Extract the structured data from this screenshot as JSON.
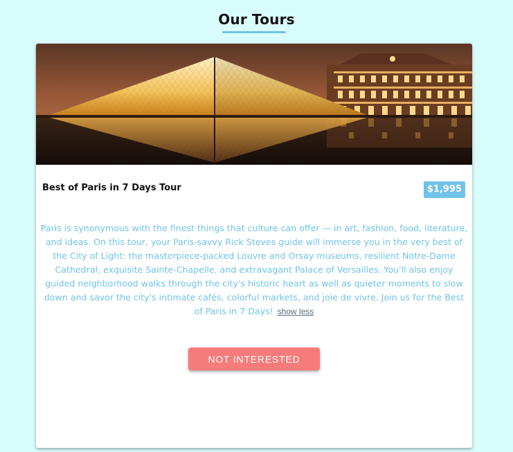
{
  "page": {
    "title": "Our Tours"
  },
  "tour": {
    "name": "Best of Paris in 7 Days Tour",
    "price": "$1,995",
    "image_alt": "Louvre pyramid at night",
    "description": "Paris is synonymous with the finest things that culture can offer — in art, fashion, food, literature, and ideas. On this tour, your Paris-savvy Rick Steves guide will immerse you in the very best of the City of Light: the masterpiece-packed Louvre and Orsay museums, resilient Notre-Dame Cathedral, exquisite Sainte-Chapelle, and extravagant Palace of Versailles. You'll also enjoy guided neighborhood walks through the city's historic heart as well as quieter moments to slow down and savor the city's intimate cafés, colorful markets, and joie de vivre. Join us for the Best of Paris in 7 Days!",
    "show_less_label": "show less",
    "button_label": "NOT INTERESTED"
  },
  "colors": {
    "background": "#d9fdfc",
    "accent": "#71c3ea",
    "button": "#f67b7b"
  }
}
